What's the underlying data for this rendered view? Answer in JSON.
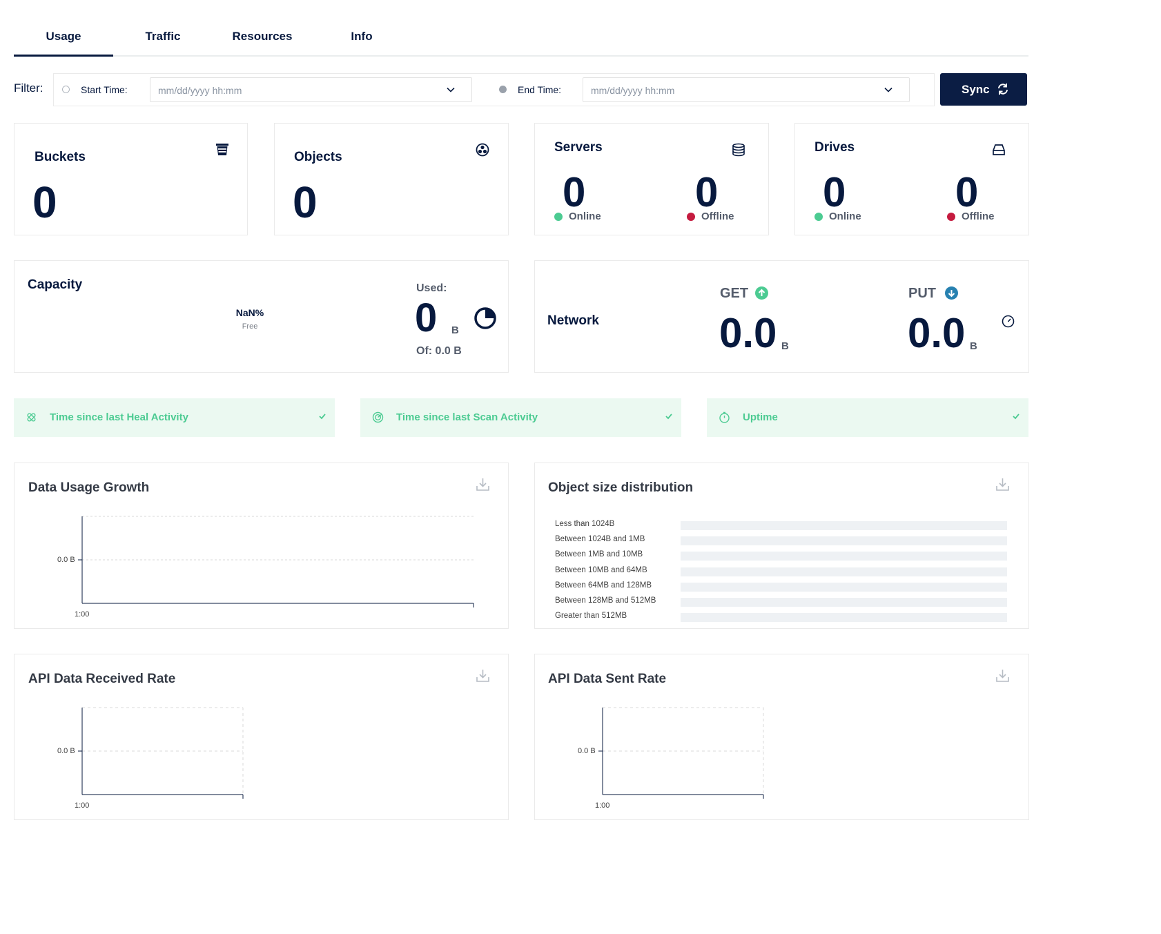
{
  "tabs": [
    {
      "label": "Usage",
      "active": true
    },
    {
      "label": "Traffic",
      "active": false
    },
    {
      "label": "Resources",
      "active": false
    },
    {
      "label": "Info",
      "active": false
    }
  ],
  "filter": {
    "label": "Filter:",
    "start_label": "Start Time:",
    "start_placeholder": "mm/dd/yyyy hh:mm",
    "end_label": "End Time:",
    "end_placeholder": "mm/dd/yyyy hh:mm",
    "sync_label": "Sync"
  },
  "cards": {
    "buckets": {
      "title": "Buckets",
      "value": "0",
      "icon": "bucket-icon"
    },
    "objects": {
      "title": "Objects",
      "value": "0",
      "icon": "objects-icon"
    },
    "servers": {
      "title": "Servers",
      "online": "0",
      "online_label": "Online",
      "offline": "0",
      "offline_label": "Offline",
      "icon": "servers-icon"
    },
    "drives": {
      "title": "Drives",
      "online": "0",
      "online_label": "Online",
      "offline": "0",
      "offline_label": "Offline",
      "icon": "drive-icon"
    }
  },
  "capacity": {
    "title": "Capacity",
    "percent": "NaN%",
    "free_label": "Free",
    "used_label": "Used:",
    "used_value": "0",
    "used_unit": "B",
    "of_label": "Of: 0.0 B"
  },
  "network": {
    "title": "Network",
    "get_label": "GET",
    "get_value": "0.0",
    "get_unit": "B",
    "put_label": "PUT",
    "put_value": "0.0",
    "put_unit": "B"
  },
  "status_bars": [
    {
      "label": "Time since last Heal Activity",
      "icon": "heal-icon"
    },
    {
      "label": "Time since last Scan Activity",
      "icon": "scan-icon"
    },
    {
      "label": "Uptime",
      "icon": "timer-icon"
    }
  ],
  "colors": {
    "primary": "#07193e",
    "online": "#4ccb92",
    "offline": "#c51b3f",
    "status_bg": "#ebf9f1",
    "get_icon": "#4ccb92",
    "put_icon": "#2781b0"
  },
  "charts": {
    "data_usage": {
      "title": "Data Usage Growth",
      "y_tick": "0.0 B",
      "x_tick": "1:00"
    },
    "object_dist": {
      "title": "Object size distribution",
      "rows": [
        "Less than 1024B",
        "Between 1024B and 1MB",
        "Between 1MB and 10MB",
        "Between 10MB and 64MB",
        "Between 64MB and 128MB",
        "Between 128MB and 512MB",
        "Greater than 512MB"
      ]
    },
    "api_received": {
      "title": "API Data Received Rate",
      "y_tick": "0.0 B",
      "x_tick": "1:00"
    },
    "api_sent": {
      "title": "API Data Sent Rate",
      "y_tick": "0.0 B",
      "x_tick": "1:00"
    }
  }
}
